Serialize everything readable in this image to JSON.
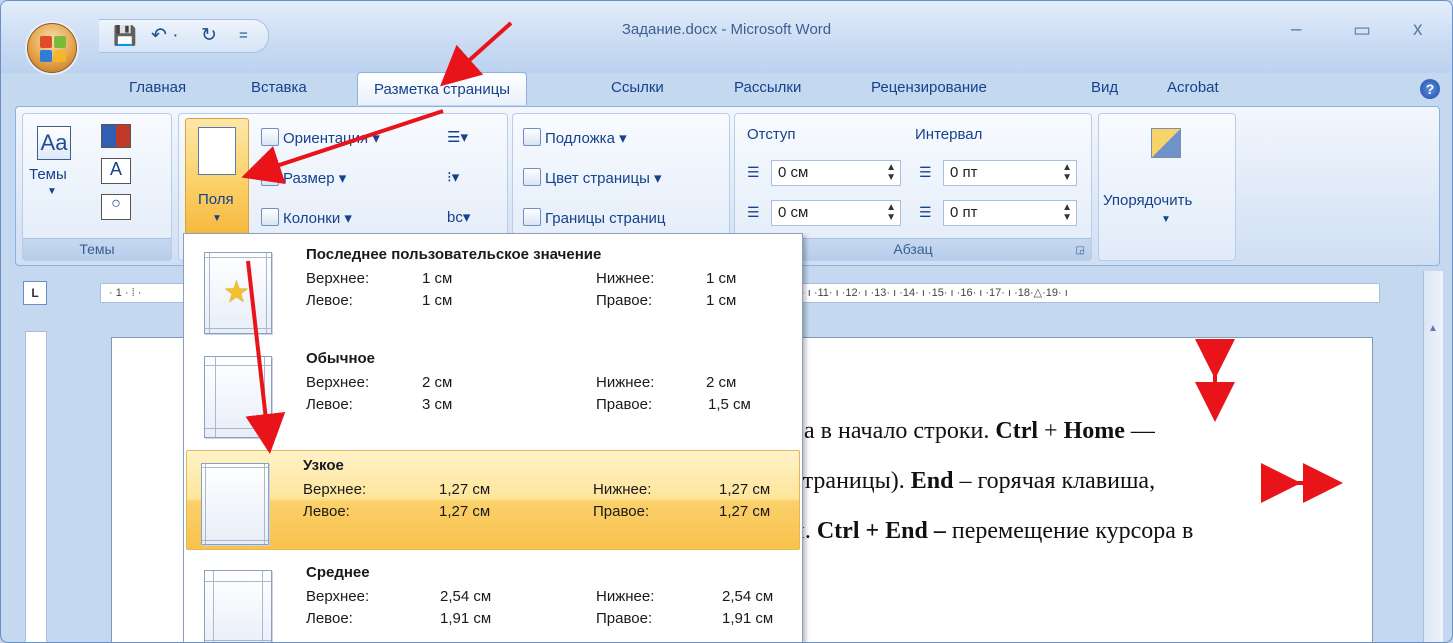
{
  "window": {
    "title": "Задание.docx - Microsoft Word",
    "minimize": "–",
    "maximize": "▭",
    "close": "x"
  },
  "qat": {
    "save": "💾",
    "undo": "↶ ·",
    "redo": "↻",
    "more": "="
  },
  "tabs": [
    {
      "label": "Главная"
    },
    {
      "label": "Вставка"
    },
    {
      "label": "Разметка страницы"
    },
    {
      "label": "Ссылки"
    },
    {
      "label": "Рассылки"
    },
    {
      "label": "Рецензирование"
    },
    {
      "label": "Вид"
    },
    {
      "label": "Acrobat"
    }
  ],
  "ribbon": {
    "themes": {
      "button": "Темы",
      "group": "Темы"
    },
    "page_setup": {
      "fields": "Поля",
      "orientation": "Ориентация ▾",
      "size": "Размер ▾",
      "columns": "Колонки ▾"
    },
    "page_background": {
      "watermark": "Подложка ▾",
      "page_color": "Цвет страницы ▾",
      "page_borders": "Границы страниц"
    },
    "paragraph": {
      "indent_label": "Отступ",
      "interval_label": "Интервал",
      "indent_left": "0 см",
      "indent_right": "0 см",
      "spacing_before": "0 пт",
      "spacing_after": "0 пт",
      "group": "Абзац"
    },
    "arrange": {
      "button": "Упорядочить"
    }
  },
  "ruler": {
    "left_text": "· 1 · ⁞ ·",
    "right_text": "· ı ·11· ı ·12· ı ·13· ı ·14· ı ·15· ı ·16· ı ·17· ı ·18·△·19· ı"
  },
  "document": {
    "line1_pre": "ра в начало строки. ",
    "line1_b1": "Ctrl",
    "line1_mid": " + ",
    "line1_b2": "Home",
    "line1_post": " —",
    "line2_pre": "страницы). ",
    "line2_b": "End",
    "line2_post": " – горячая клавиша,",
    "line3_pre": "и. ",
    "line3_b": "Ctrl + End",
    "line3_mid": " –",
    "line3_post": " перемещение курсора в"
  },
  "margins_gallery": [
    {
      "title": "Последнее пользовательское значение",
      "top_label": "Верхнее:",
      "top": "1 см",
      "bottom_label": "Нижнее:",
      "bottom": "1 см",
      "left_label": "Левое:",
      "left": "1 см",
      "right_label": "Правое:",
      "right": "1 см"
    },
    {
      "title": "Обычное",
      "top_label": "Верхнее:",
      "top": "2 см",
      "bottom_label": "Нижнее:",
      "bottom": "2 см",
      "left_label": "Левое:",
      "left": "3 см",
      "right_label": "Правое:",
      "right": "1,5 см"
    },
    {
      "title": "Узкое",
      "top_label": "Верхнее:",
      "top": "1,27 см",
      "bottom_label": "Нижнее:",
      "bottom": "1,27 см",
      "left_label": "Левое:",
      "left": "1,27 см",
      "right_label": "Правое:",
      "right": "1,27 см"
    },
    {
      "title": "Среднее",
      "top_label": "Верхнее:",
      "top": "2,54 см",
      "bottom_label": "Нижнее:",
      "bottom": "2,54 см",
      "left_label": "Левое:",
      "left": "1,91 см",
      "right_label": "Правое:",
      "right": "1,91 см"
    }
  ],
  "highlight_color": "#fbd66a",
  "annotation_color": "#e8141a"
}
